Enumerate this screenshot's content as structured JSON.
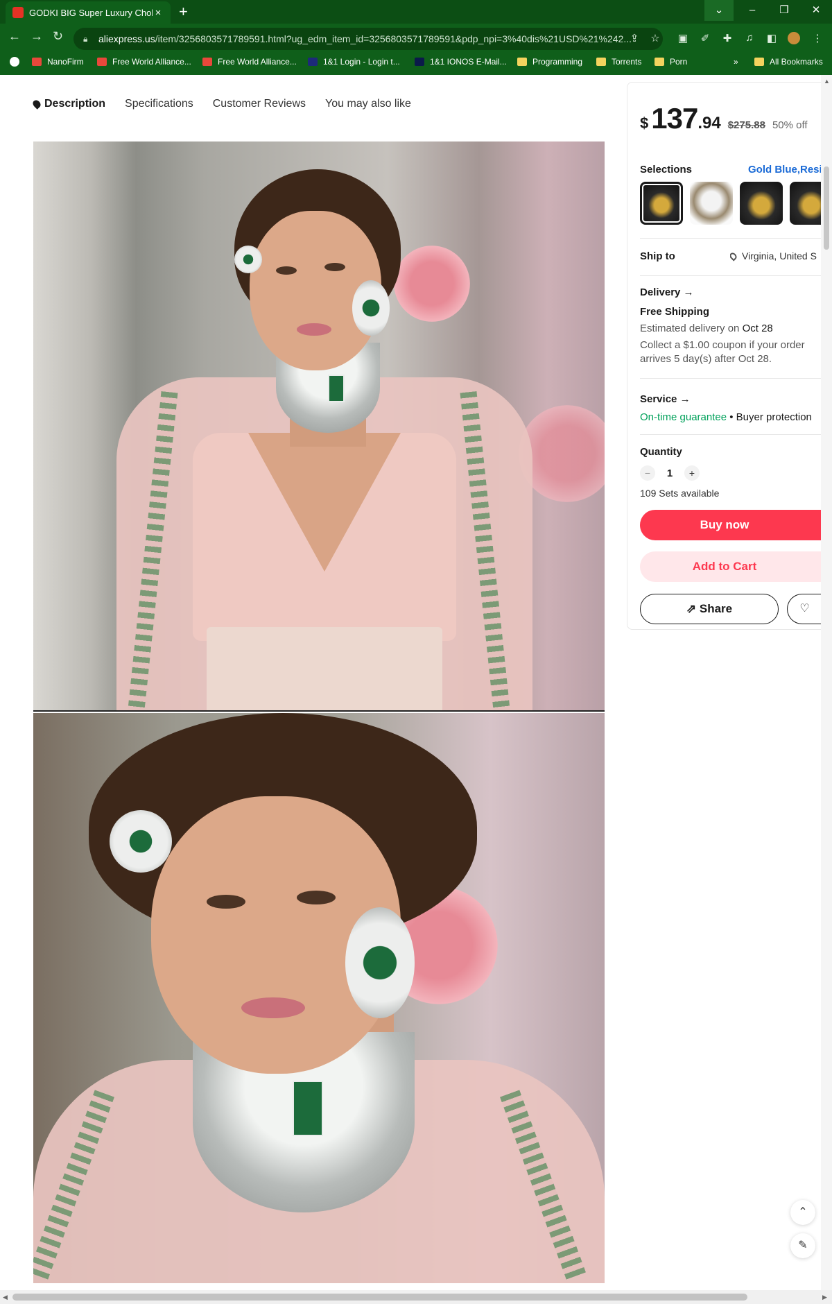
{
  "browser": {
    "tab_title": "GODKI BIG Super Luxury Choker",
    "tab_close": "×",
    "new_tab": "+",
    "url_host": "aliexpress.us",
    "url_path": "/item/3256803571789591.html?ug_edm_item_id=3256803571789591&pdp_npi=3%40dis%21USD%21%242...",
    "bookmarks": [
      "NanoFirm",
      "Free World Alliance...",
      "Free World Alliance...",
      "1&1 Login - Login t...",
      "1&1 IONOS E-Mail...",
      "Programming",
      "Torrents",
      "Porn"
    ],
    "bookmarks_overflow": "»",
    "all_bookmarks": "All Bookmarks"
  },
  "subnav": {
    "items": [
      "Description",
      "Specifications",
      "Customer Reviews",
      "You may also like"
    ]
  },
  "product": {
    "currency": "$",
    "price_int": "137",
    "price_dec": ".94",
    "price_old": "$275.88",
    "discount": "50% off",
    "selections_label": "Selections",
    "selection_value": "Gold Blue,Resiz",
    "selected_index": 0,
    "ship_to_label": "Ship to",
    "ship_to_value": "Virginia, United S",
    "delivery_label": "Delivery",
    "shipping": "Free Shipping",
    "est_delivery_prefix": "Estimated delivery on ",
    "est_delivery_date": "Oct 28",
    "coupon_line1": "Collect a $1.00 coupon if your order",
    "coupon_line2": "arrives 5 day(s) after Oct 28.",
    "service_label": "Service",
    "guarantee": "On-time guarantee",
    "protection": " • Buyer protection",
    "quantity_label": "Quantity",
    "quantity": "1",
    "available": "109 Sets available",
    "buy_now": "Buy now",
    "add_to_cart": "Add to Cart",
    "share": "Share"
  },
  "icons": {
    "arrow": "→",
    "minus": "−",
    "plus": "+",
    "share": "⇗",
    "heart": "♡",
    "up": "⌃",
    "edit": "✎"
  },
  "colors": {
    "browser_frame": "#0f5f1a",
    "buy_button": "#fd384f",
    "cart_button_bg": "#ffe7ea",
    "selection_link": "#1a6ad6",
    "guarantee": "#00a15a"
  }
}
